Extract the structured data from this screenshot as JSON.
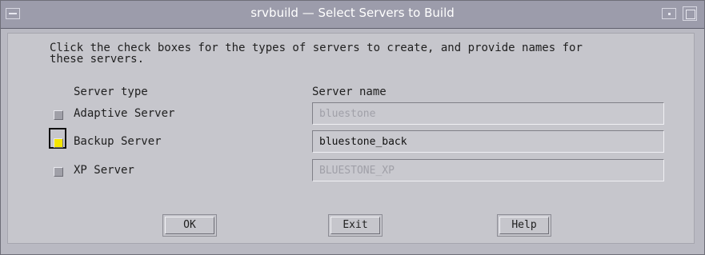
{
  "window": {
    "title": "srvbuild — Select Servers to Build"
  },
  "dialog": {
    "instructions": "Click the check boxes for the types of servers to create, and provide names for\nthese servers.",
    "headers": {
      "server_type": "Server type",
      "server_name": "Server name"
    },
    "rows": [
      {
        "type_label": "Adaptive Server",
        "checked": false,
        "name_value": "bluestone"
      },
      {
        "type_label": "Backup Server",
        "checked": true,
        "name_value": "bluestone_back"
      },
      {
        "type_label": "XP Server",
        "checked": false,
        "name_value": "BLUESTONE_XP"
      }
    ]
  },
  "buttons": {
    "ok": "OK",
    "exit": "Exit",
    "help": "Help"
  },
  "colors": {
    "check_on": "#f5e600",
    "titlebar": "#9c9cab",
    "background": "#c6c6cc"
  }
}
